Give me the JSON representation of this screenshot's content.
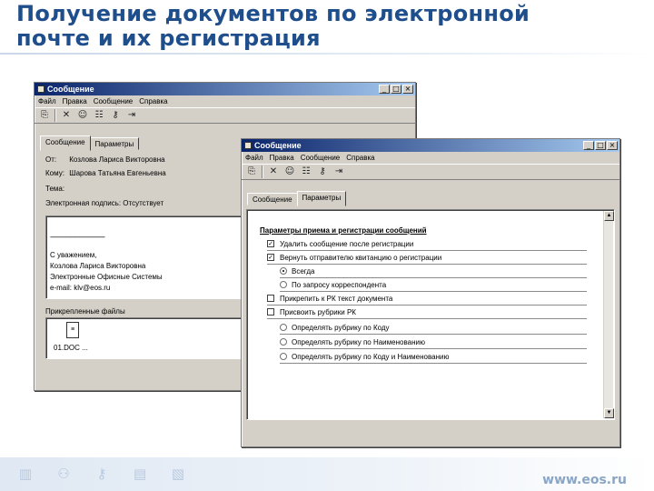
{
  "slide": {
    "title_line1": "Получение документов по электронной",
    "title_line2": "почте и их регистрация"
  },
  "colors": {
    "title": "#1f4e8c",
    "titlebar_start": "#0a246a",
    "titlebar_end": "#a6caf0",
    "footer_url": "#8aa6c6"
  },
  "back_window": {
    "title": "Сообщение",
    "menu": [
      "Файл",
      "Правка",
      "Сообщение",
      "Справка"
    ],
    "tabs": [
      "Сообщение",
      "Параметры"
    ],
    "fields": [
      {
        "label": "От:",
        "value": "Козлова Лариса Викторовна"
      },
      {
        "label": "Кому:",
        "value": "Шарова Татьяна Евгеньевна"
      },
      {
        "label": "Тема:",
        "value": ""
      }
    ],
    "signature_line": "Электронная подпись: Отсутствует",
    "body_lines": [
      "------------------------------------",
      "С уважением,",
      "Козлова Лариса Викторовна",
      "Электронные Офисные Системы",
      "e-mail: klv@eos.ru"
    ],
    "attachments_label": "Прикрепленные файлы",
    "attachment_name": "01.DOC ..."
  },
  "front_window": {
    "title": "Сообщение",
    "menu": [
      "Файл",
      "Правка",
      "Сообщение",
      "Справка"
    ],
    "tabs": [
      "Сообщение",
      "Параметры"
    ],
    "section_title": "Параметры приема и регистрации сообщений",
    "options": [
      {
        "kind": "check",
        "checked": true,
        "label": "Удалить сообщение после регистрации"
      },
      {
        "kind": "check",
        "checked": true,
        "label": "Вернуть отправителю квитанцию о регистрации"
      },
      {
        "kind": "radio",
        "checked": true,
        "label": "Всегда"
      },
      {
        "kind": "radio",
        "checked": false,
        "label": "По запросу корреспондента"
      },
      {
        "kind": "check",
        "checked": false,
        "label": "Прикрепить к РК текст документа"
      },
      {
        "kind": "check",
        "checked": false,
        "label": "Присвоить рубрики РК"
      },
      {
        "kind": "radio",
        "checked": false,
        "label": "Определять рубрику по Коду"
      },
      {
        "kind": "radio",
        "checked": false,
        "label": "Определять рубрику по Наименованию"
      },
      {
        "kind": "radio",
        "checked": false,
        "label": "Определять рубрику по Коду и Наименованию"
      }
    ]
  },
  "window_buttons": {
    "minimize": "_",
    "maximize": "□",
    "close": "×"
  },
  "footer": {
    "url": "www.eos.ru"
  }
}
